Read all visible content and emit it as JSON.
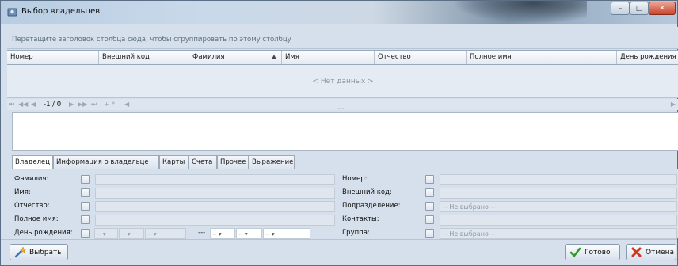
{
  "window": {
    "title": "Выбор владельцев",
    "minimize": "–",
    "maximize": "□",
    "close": "✕"
  },
  "grid": {
    "group_hint": "Перетащите заголовок столбца сюда, чтобы сгруппировать по этому столбцу",
    "columns": [
      "Номер",
      "Внешний код",
      "Фамилия",
      "Имя",
      "Отчество",
      "Полное имя",
      "День рождения"
    ],
    "sort_indicator": "▲",
    "empty_text": "< Нет данных >",
    "pager_position": "-1 / 0",
    "pager_first": "⏮",
    "pager_prev_page": "◀◀",
    "pager_prev": "◀",
    "pager_next": "▶",
    "pager_next_page": "▶▶",
    "pager_last": "⏭",
    "pager_add": "+",
    "pager_edit": "*",
    "pager_scroll": "◀",
    "resize_grip": "·····"
  },
  "tabs": [
    "Владелец",
    "Информация о владельце",
    "Карты",
    "Счета",
    "Прочее",
    "Выражение"
  ],
  "form": {
    "left": {
      "surname": "Фамилия:",
      "name": "Имя:",
      "patronymic": "Отчество:",
      "full_name": "Полное имя:",
      "birthday": "День рождения:"
    },
    "right": {
      "number": "Номер:",
      "external_code": "Внешний код:",
      "department": "Подразделение:",
      "contacts": "Контакты:",
      "group": "Группа:"
    },
    "not_selected": "-- Не выбрано --",
    "date_placeholder": "--",
    "date_arrow": "▾",
    "date_separator": "---"
  },
  "footer": {
    "select_label": "Выбрать",
    "done_label": "Готово",
    "cancel_label": "Отмена"
  },
  "colors": {
    "window_bg": "#d5e0ec",
    "border": "#5a6f86",
    "close_button": "#c9452c"
  }
}
